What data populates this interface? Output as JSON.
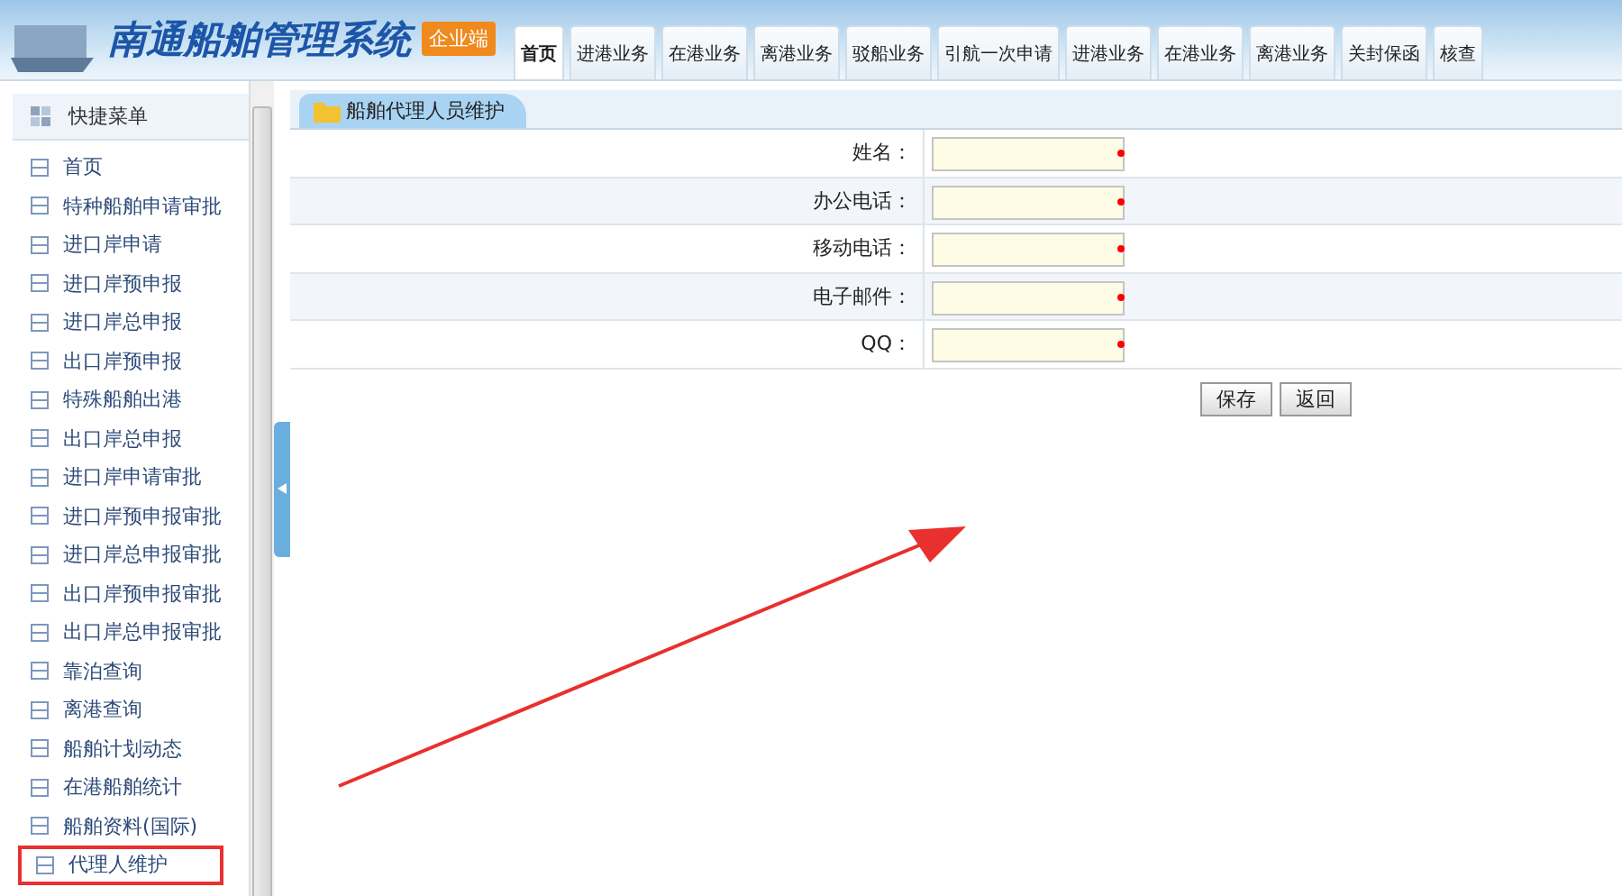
{
  "header": {
    "title": "南通船舶管理系统",
    "badge": "企业端"
  },
  "nav_tabs": [
    {
      "label": "首页",
      "selected": true
    },
    {
      "label": "进港业务",
      "selected": false
    },
    {
      "label": "在港业务",
      "selected": false
    },
    {
      "label": "离港业务",
      "selected": false
    },
    {
      "label": "驳船业务",
      "selected": false
    },
    {
      "label": "引航一次申请",
      "selected": false
    },
    {
      "label": "进港业务",
      "selected": false
    },
    {
      "label": "在港业务",
      "selected": false
    },
    {
      "label": "离港业务",
      "selected": false
    },
    {
      "label": "关封保函",
      "selected": false
    },
    {
      "label": "核查",
      "selected": false
    }
  ],
  "sidebar": {
    "title": "快捷菜单",
    "items": [
      {
        "label": "首页",
        "highlighted": false
      },
      {
        "label": "特种船舶申请审批",
        "highlighted": false
      },
      {
        "label": "进口岸申请",
        "highlighted": false
      },
      {
        "label": "进口岸预申报",
        "highlighted": false
      },
      {
        "label": "进口岸总申报",
        "highlighted": false
      },
      {
        "label": "出口岸预申报",
        "highlighted": false
      },
      {
        "label": "特殊船舶出港",
        "highlighted": false
      },
      {
        "label": "出口岸总申报",
        "highlighted": false
      },
      {
        "label": "进口岸申请审批",
        "highlighted": false
      },
      {
        "label": "进口岸预申报审批",
        "highlighted": false
      },
      {
        "label": "进口岸总申报审批",
        "highlighted": false
      },
      {
        "label": "出口岸预申报审批",
        "highlighted": false
      },
      {
        "label": "出口岸总申报审批",
        "highlighted": false
      },
      {
        "label": "靠泊查询",
        "highlighted": false
      },
      {
        "label": "离港查询",
        "highlighted": false
      },
      {
        "label": "船舶计划动态",
        "highlighted": false
      },
      {
        "label": "在港船舶统计",
        "highlighted": false
      },
      {
        "label": "船舶资料(国际)",
        "highlighted": false
      },
      {
        "label": "代理人维护",
        "highlighted": true
      }
    ]
  },
  "panel": {
    "tab": "船舶代理人员维护",
    "fields": [
      {
        "label": "姓名：",
        "required": true
      },
      {
        "label": "办公电话：",
        "required": true
      },
      {
        "label": "移动电话：",
        "required": true
      },
      {
        "label": "电子邮件：",
        "required": true
      },
      {
        "label": "QQ：",
        "required": true
      }
    ],
    "buttons": [
      "保存",
      "返回"
    ]
  }
}
